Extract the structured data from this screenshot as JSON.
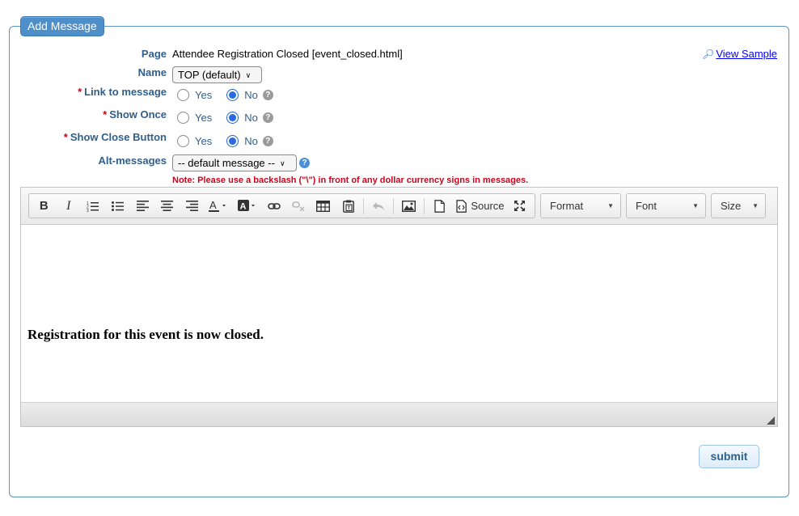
{
  "legend": "Add Message",
  "view_sample": "View Sample",
  "page": {
    "label": "Page",
    "value": "Attendee Registration Closed [event_closed.html]"
  },
  "name": {
    "label": "Name",
    "selected": "TOP (default)"
  },
  "link_to_message": {
    "label": "Link to message",
    "required_mark": "*",
    "options": [
      "Yes",
      "No"
    ],
    "selected": "No"
  },
  "show_once": {
    "label": "Show Once",
    "required_mark": "*",
    "options": [
      "Yes",
      "No"
    ],
    "selected": "No"
  },
  "show_close_button": {
    "label": "Show Close Button",
    "required_mark": "*",
    "options": [
      "Yes",
      "No"
    ],
    "selected": "No"
  },
  "alt_messages": {
    "label": "Alt-messages",
    "selected": "-- default message --"
  },
  "note": "Note: Please use a backslash (\"\\\") in front of any dollar currency signs in messages.",
  "toolbar": {
    "bold": "B",
    "italic": "I",
    "source_label": "Source",
    "format_label": "Format",
    "font_label": "Font",
    "size_label": "Size"
  },
  "editor": {
    "content": "Registration for this event is now closed."
  },
  "submit_label": "submit",
  "colors": {
    "accent": "#4e8fc9",
    "label": "#2f5f8c",
    "required": "#d0021b"
  }
}
